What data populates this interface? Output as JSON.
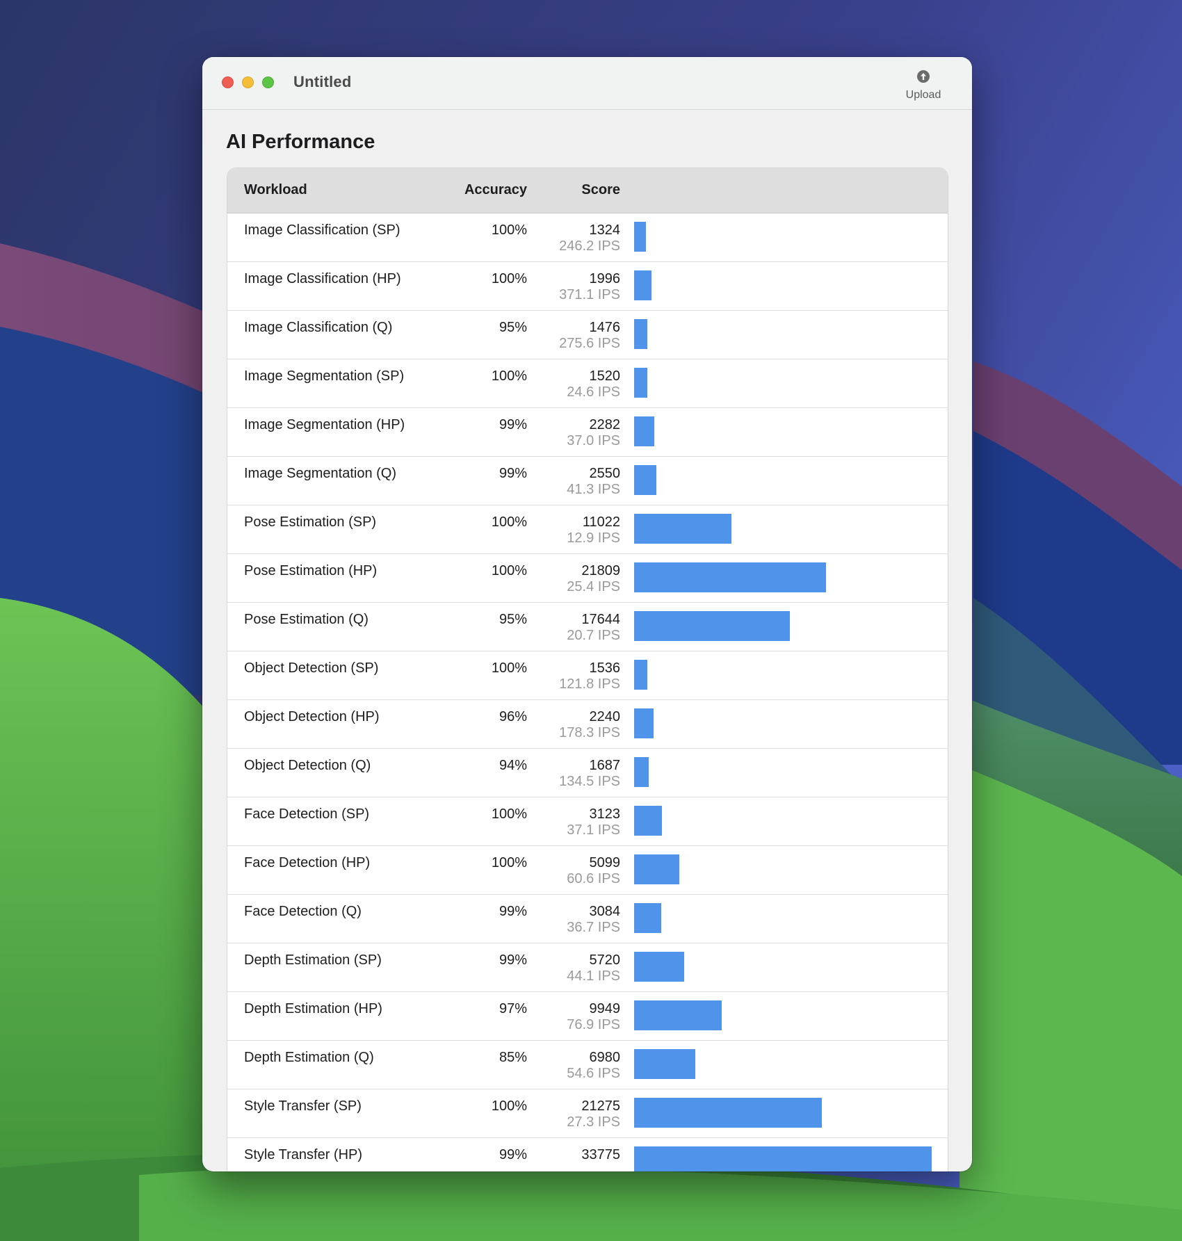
{
  "window": {
    "title": "Untitled"
  },
  "toolbar": {
    "upload_label": "Upload"
  },
  "page": {
    "title": "AI Performance"
  },
  "table": {
    "columns": {
      "workload": "Workload",
      "accuracy": "Accuracy",
      "score": "Score"
    },
    "max_score": 33775,
    "rows": [
      {
        "workload": "Image Classification (SP)",
        "accuracy": "100%",
        "score": "1324",
        "ips": "246.2 IPS",
        "score_value": 1324
      },
      {
        "workload": "Image Classification (HP)",
        "accuracy": "100%",
        "score": "1996",
        "ips": "371.1 IPS",
        "score_value": 1996
      },
      {
        "workload": "Image Classification (Q)",
        "accuracy": "95%",
        "score": "1476",
        "ips": "275.6 IPS",
        "score_value": 1476
      },
      {
        "workload": "Image Segmentation (SP)",
        "accuracy": "100%",
        "score": "1520",
        "ips": "24.6 IPS",
        "score_value": 1520
      },
      {
        "workload": "Image Segmentation (HP)",
        "accuracy": "99%",
        "score": "2282",
        "ips": "37.0 IPS",
        "score_value": 2282
      },
      {
        "workload": "Image Segmentation (Q)",
        "accuracy": "99%",
        "score": "2550",
        "ips": "41.3 IPS",
        "score_value": 2550
      },
      {
        "workload": "Pose Estimation (SP)",
        "accuracy": "100%",
        "score": "11022",
        "ips": "12.9 IPS",
        "score_value": 11022
      },
      {
        "workload": "Pose Estimation (HP)",
        "accuracy": "100%",
        "score": "21809",
        "ips": "25.4 IPS",
        "score_value": 21809
      },
      {
        "workload": "Pose Estimation (Q)",
        "accuracy": "95%",
        "score": "17644",
        "ips": "20.7 IPS",
        "score_value": 17644
      },
      {
        "workload": "Object Detection (SP)",
        "accuracy": "100%",
        "score": "1536",
        "ips": "121.8 IPS",
        "score_value": 1536
      },
      {
        "workload": "Object Detection (HP)",
        "accuracy": "96%",
        "score": "2240",
        "ips": "178.3 IPS",
        "score_value": 2240
      },
      {
        "workload": "Object Detection (Q)",
        "accuracy": "94%",
        "score": "1687",
        "ips": "134.5 IPS",
        "score_value": 1687
      },
      {
        "workload": "Face Detection (SP)",
        "accuracy": "100%",
        "score": "3123",
        "ips": "37.1 IPS",
        "score_value": 3123
      },
      {
        "workload": "Face Detection (HP)",
        "accuracy": "100%",
        "score": "5099",
        "ips": "60.6 IPS",
        "score_value": 5099
      },
      {
        "workload": "Face Detection (Q)",
        "accuracy": "99%",
        "score": "3084",
        "ips": "36.7 IPS",
        "score_value": 3084
      },
      {
        "workload": "Depth Estimation (SP)",
        "accuracy": "99%",
        "score": "5720",
        "ips": "44.1 IPS",
        "score_value": 5720
      },
      {
        "workload": "Depth Estimation (HP)",
        "accuracy": "97%",
        "score": "9949",
        "ips": "76.9 IPS",
        "score_value": 9949
      },
      {
        "workload": "Depth Estimation (Q)",
        "accuracy": "85%",
        "score": "6980",
        "ips": "54.6 IPS",
        "score_value": 6980
      },
      {
        "workload": "Style Transfer (SP)",
        "accuracy": "100%",
        "score": "21275",
        "ips": "27.3 IPS",
        "score_value": 21275
      },
      {
        "workload": "Style Transfer (HP)",
        "accuracy": "99%",
        "score": "33775",
        "ips": "",
        "score_value": 33775
      }
    ]
  },
  "colors": {
    "bar": "#4f93ea",
    "traffic_red": "#ee5e55",
    "traffic_yellow": "#f4bd3a",
    "traffic_green": "#5ec446"
  },
  "icons": {
    "upload": "upload-arrow-circle-icon"
  }
}
